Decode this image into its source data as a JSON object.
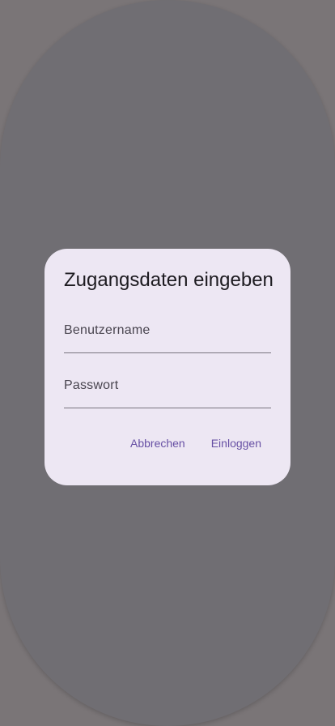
{
  "dialog": {
    "title": "Zugangsdaten eingeben",
    "username_label": "Benutzername",
    "password_label": "Passwort",
    "cancel_label": "Abbrechen",
    "login_label": "Einloggen"
  },
  "colors": {
    "scrim": "#7a7577",
    "dialog_surface": "#ede7f3",
    "primary_text_button": "#6750a4",
    "on_surface": "#1d1b20",
    "outline": "#79747e"
  }
}
